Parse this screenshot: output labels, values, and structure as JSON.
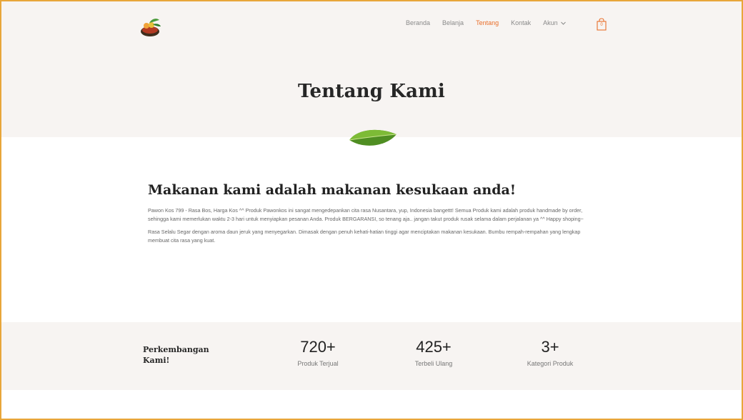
{
  "nav": {
    "items": [
      {
        "label": "Beranda",
        "active": false
      },
      {
        "label": "Belanja",
        "active": false
      },
      {
        "label": "Tentang",
        "active": true
      },
      {
        "label": "Kontak",
        "active": false
      }
    ],
    "account_label": "Akun",
    "cart_count": "0"
  },
  "hero": {
    "title": "Tentang Kami"
  },
  "about": {
    "heading": "Makanan kami adalah makanan kesukaan anda!",
    "paragraph1": "Pawon Kos 799 - Rasa Bos, Harga Kos ^^ Produk Pawonkos ini sangat mengedepankan cita rasa Nusantara, yup, Indonesia bangettt! Semua Produk kami adalah produk handmade by order, sehingga kami memerlukan waktu 2-3 hari untuk menyiapkan pesanan Anda. Produk BERGARANSI, so tenang aja.. jangan takut produk rusak selama dalam perjalanan ya ^^ Happy shoping~",
    "paragraph2": "Rasa Selalu Segar dengan aroma daun jeruk yang menyegarkan. Dimasak dengan penuh kehati-hatian tinggi agar menciptakan makanan kesukaan. Bumbu rempah-rempahan yang lengkap membuat cita rasa yang kuat."
  },
  "stats": {
    "title": "Perkembangan Kami!",
    "items": [
      {
        "value": "720+",
        "label": "Produk Terjual"
      },
      {
        "value": "425+",
        "label": "Terbeli Ulang"
      },
      {
        "value": "3+",
        "label": "Kategori Produk"
      }
    ]
  },
  "colors": {
    "accent": "#e96f2b",
    "hero_bg": "#f7f4f2",
    "frame": "#e8a63a"
  },
  "icons": {
    "logo": "pawon-kos-logo",
    "cart": "shopping-bag-icon",
    "chevron": "chevron-down-icon",
    "leaf": "leaf-image"
  }
}
